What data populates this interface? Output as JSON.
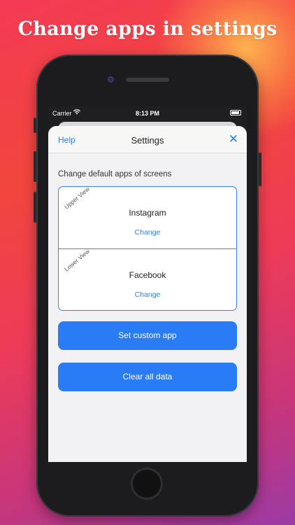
{
  "headline": "Change apps in settings",
  "status_bar": {
    "carrier": "Carrier",
    "time": "8:13 PM",
    "wifi_icon": "wifi-icon",
    "battery_icon": "battery-icon"
  },
  "navbar": {
    "help_label": "Help",
    "title": "Settings",
    "close_icon": "close-icon",
    "close_glyph": "✕"
  },
  "section_label": "Change default apps of screens",
  "views": {
    "upper": {
      "tag": "Upper View",
      "app": "Instagram",
      "change_label": "Change"
    },
    "lower": {
      "tag": "Lower View",
      "app": "Facebook",
      "change_label": "Change"
    }
  },
  "buttons": {
    "set_custom_app": "Set custom app",
    "clear_all_data": "Clear all data"
  },
  "colors": {
    "accent": "#2a7cf6",
    "link": "#2d7ff2"
  }
}
